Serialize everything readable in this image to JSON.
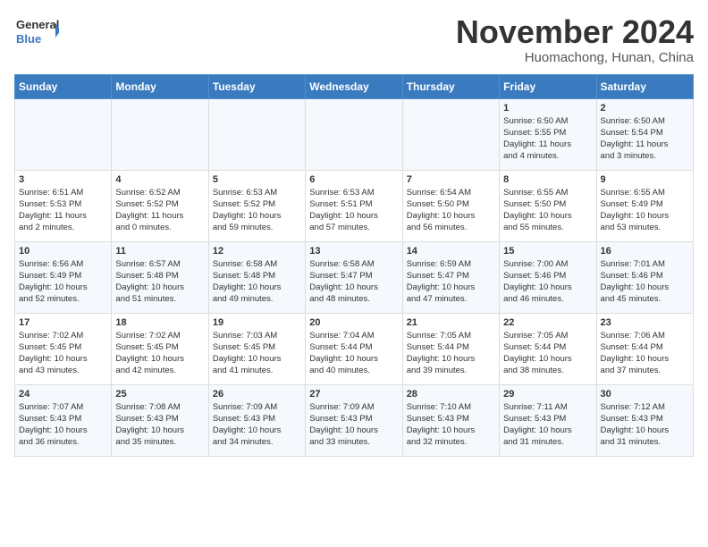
{
  "logo": {
    "line1": "General",
    "line2": "Blue"
  },
  "title": "November 2024",
  "subtitle": "Huomachong, Hunan, China",
  "weekdays": [
    "Sunday",
    "Monday",
    "Tuesday",
    "Wednesday",
    "Thursday",
    "Friday",
    "Saturday"
  ],
  "weeks": [
    [
      {
        "day": "",
        "info": ""
      },
      {
        "day": "",
        "info": ""
      },
      {
        "day": "",
        "info": ""
      },
      {
        "day": "",
        "info": ""
      },
      {
        "day": "",
        "info": ""
      },
      {
        "day": "1",
        "info": "Sunrise: 6:50 AM\nSunset: 5:55 PM\nDaylight: 11 hours\nand 4 minutes."
      },
      {
        "day": "2",
        "info": "Sunrise: 6:50 AM\nSunset: 5:54 PM\nDaylight: 11 hours\nand 3 minutes."
      }
    ],
    [
      {
        "day": "3",
        "info": "Sunrise: 6:51 AM\nSunset: 5:53 PM\nDaylight: 11 hours\nand 2 minutes."
      },
      {
        "day": "4",
        "info": "Sunrise: 6:52 AM\nSunset: 5:52 PM\nDaylight: 11 hours\nand 0 minutes."
      },
      {
        "day": "5",
        "info": "Sunrise: 6:53 AM\nSunset: 5:52 PM\nDaylight: 10 hours\nand 59 minutes."
      },
      {
        "day": "6",
        "info": "Sunrise: 6:53 AM\nSunset: 5:51 PM\nDaylight: 10 hours\nand 57 minutes."
      },
      {
        "day": "7",
        "info": "Sunrise: 6:54 AM\nSunset: 5:50 PM\nDaylight: 10 hours\nand 56 minutes."
      },
      {
        "day": "8",
        "info": "Sunrise: 6:55 AM\nSunset: 5:50 PM\nDaylight: 10 hours\nand 55 minutes."
      },
      {
        "day": "9",
        "info": "Sunrise: 6:55 AM\nSunset: 5:49 PM\nDaylight: 10 hours\nand 53 minutes."
      }
    ],
    [
      {
        "day": "10",
        "info": "Sunrise: 6:56 AM\nSunset: 5:49 PM\nDaylight: 10 hours\nand 52 minutes."
      },
      {
        "day": "11",
        "info": "Sunrise: 6:57 AM\nSunset: 5:48 PM\nDaylight: 10 hours\nand 51 minutes."
      },
      {
        "day": "12",
        "info": "Sunrise: 6:58 AM\nSunset: 5:48 PM\nDaylight: 10 hours\nand 49 minutes."
      },
      {
        "day": "13",
        "info": "Sunrise: 6:58 AM\nSunset: 5:47 PM\nDaylight: 10 hours\nand 48 minutes."
      },
      {
        "day": "14",
        "info": "Sunrise: 6:59 AM\nSunset: 5:47 PM\nDaylight: 10 hours\nand 47 minutes."
      },
      {
        "day": "15",
        "info": "Sunrise: 7:00 AM\nSunset: 5:46 PM\nDaylight: 10 hours\nand 46 minutes."
      },
      {
        "day": "16",
        "info": "Sunrise: 7:01 AM\nSunset: 5:46 PM\nDaylight: 10 hours\nand 45 minutes."
      }
    ],
    [
      {
        "day": "17",
        "info": "Sunrise: 7:02 AM\nSunset: 5:45 PM\nDaylight: 10 hours\nand 43 minutes."
      },
      {
        "day": "18",
        "info": "Sunrise: 7:02 AM\nSunset: 5:45 PM\nDaylight: 10 hours\nand 42 minutes."
      },
      {
        "day": "19",
        "info": "Sunrise: 7:03 AM\nSunset: 5:45 PM\nDaylight: 10 hours\nand 41 minutes."
      },
      {
        "day": "20",
        "info": "Sunrise: 7:04 AM\nSunset: 5:44 PM\nDaylight: 10 hours\nand 40 minutes."
      },
      {
        "day": "21",
        "info": "Sunrise: 7:05 AM\nSunset: 5:44 PM\nDaylight: 10 hours\nand 39 minutes."
      },
      {
        "day": "22",
        "info": "Sunrise: 7:05 AM\nSunset: 5:44 PM\nDaylight: 10 hours\nand 38 minutes."
      },
      {
        "day": "23",
        "info": "Sunrise: 7:06 AM\nSunset: 5:44 PM\nDaylight: 10 hours\nand 37 minutes."
      }
    ],
    [
      {
        "day": "24",
        "info": "Sunrise: 7:07 AM\nSunset: 5:43 PM\nDaylight: 10 hours\nand 36 minutes."
      },
      {
        "day": "25",
        "info": "Sunrise: 7:08 AM\nSunset: 5:43 PM\nDaylight: 10 hours\nand 35 minutes."
      },
      {
        "day": "26",
        "info": "Sunrise: 7:09 AM\nSunset: 5:43 PM\nDaylight: 10 hours\nand 34 minutes."
      },
      {
        "day": "27",
        "info": "Sunrise: 7:09 AM\nSunset: 5:43 PM\nDaylight: 10 hours\nand 33 minutes."
      },
      {
        "day": "28",
        "info": "Sunrise: 7:10 AM\nSunset: 5:43 PM\nDaylight: 10 hours\nand 32 minutes."
      },
      {
        "day": "29",
        "info": "Sunrise: 7:11 AM\nSunset: 5:43 PM\nDaylight: 10 hours\nand 31 minutes."
      },
      {
        "day": "30",
        "info": "Sunrise: 7:12 AM\nSunset: 5:43 PM\nDaylight: 10 hours\nand 31 minutes."
      }
    ]
  ]
}
